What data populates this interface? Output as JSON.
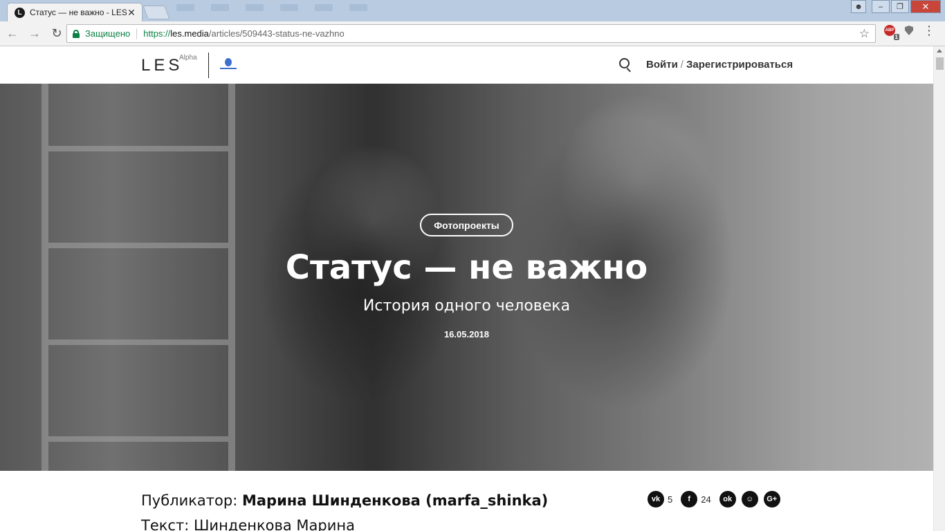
{
  "browser": {
    "tab_title": "Статус — не важно - LES",
    "tab_favicon": "L",
    "tab_close": "✕",
    "secure_label": "Защищено",
    "url_scheme": "https://",
    "url_host": "les.media",
    "url_path": "/articles/509443-status-ne-vazhno",
    "bookmark_icon": "star-icon",
    "abp_label": "ABP",
    "abp_badge": "1",
    "window_controls": {
      "minimize": "–",
      "maximize": "❐",
      "close": "✕"
    }
  },
  "header": {
    "logo": "LES",
    "logo_sup": "Alpha",
    "login": "Войти",
    "separator": "/",
    "register": "Зарегистрироваться"
  },
  "hero": {
    "category": "Фотопроекты",
    "title": "Статус — не важно",
    "subtitle": "История одного человека",
    "date": "16.05.2018"
  },
  "article": {
    "publisher_label": "Публикатор:",
    "publisher_name": "Марина Шинденкова (marfa_shinka)",
    "text_credit": "Текст: Шинденкова Марина"
  },
  "share": {
    "vk_label": "vk",
    "vk_count": "5",
    "fb_label": "f",
    "fb_count": "24",
    "ok_label": "ok",
    "mm_label": "☺",
    "gplus_label": "G+"
  }
}
